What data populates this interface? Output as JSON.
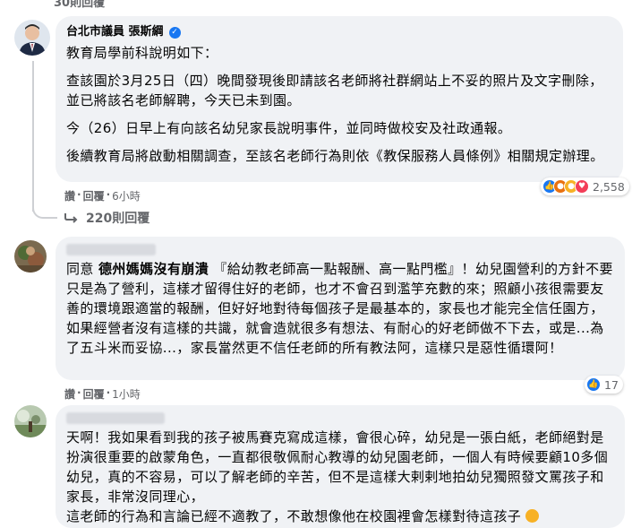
{
  "top_partial_text": "30則回覆",
  "comments": [
    {
      "author": "台北市議員 張斯綱",
      "verified": true,
      "paragraphs": [
        "教育局學前科說明如下：",
        "查該園於3月25日（四）晚間發現後即請該名老師將社群網站上不妥的照片及文字刪除，並已將該名老師解聘，今天已未到園。",
        "今（26）日早上有向該名幼兒家長說明事件，並同時做校安及社政通報。",
        "後續教育局將啟動相關調查，至該名老師行為則依《教保服務人員條例》相關規定辦理。"
      ],
      "actions": {
        "like": "讚",
        "reply": "回覆",
        "time": "6小時"
      },
      "reactions": {
        "icons": [
          "like-icon",
          "angry-icon",
          "sad-icon",
          "love-icon"
        ],
        "count": "2,558"
      }
    },
    {
      "author_hidden": true,
      "paragraphs_parts": {
        "prefix": "同意 ",
        "tagged": "德州媽媽沒有崩潰",
        "rest": " 『給幼教老師高一點報酬、高一點門檻』！幼兒園營利的方針不要只是為了營利，這樣才留得住好的老師，也才不會召到濫竽充數的來；照顧小孩很需要友善的環境跟適當的報酬，但好好地對待每個孩子是最基本的，家長也才能完全信任園方，如果經營者沒有這樣的共識，就會造就很多有想法、有耐心的好老師做不下去，或是...為了五斗米而妥協...，家長當然更不信任老師的所有教法阿，這樣只是惡性循環阿！"
      },
      "actions": {
        "like": "讚",
        "reply": "回覆",
        "time": "1小時"
      },
      "reactions": {
        "icons": [
          "like-icon"
        ],
        "count": "17"
      }
    },
    {
      "author_hidden": true,
      "paragraphs": [
        "天啊！我如果看到我的孩子被馬賽克寫成這樣，會很心碎，幼兒是一張白紙，老師絕對是扮演很重要的啟蒙角色，一直都很敬佩耐心教導的幼兒園老師，一個人有時候要顧10多個幼兒，真的不容易，可以了解老師的辛苦，但不是這樣大剌剌地拍幼兒獨照發文罵孩子和家長，非常沒同理心，",
        "這老師的行為和言論已經不適教了，不敢想像他在校園裡會怎樣對待這孩子"
      ]
    }
  ],
  "replies_link": "220則回覆",
  "colors": {
    "bubble": "#f0f2f5",
    "link_blue": "#1877f2",
    "muted": "#65676b"
  }
}
